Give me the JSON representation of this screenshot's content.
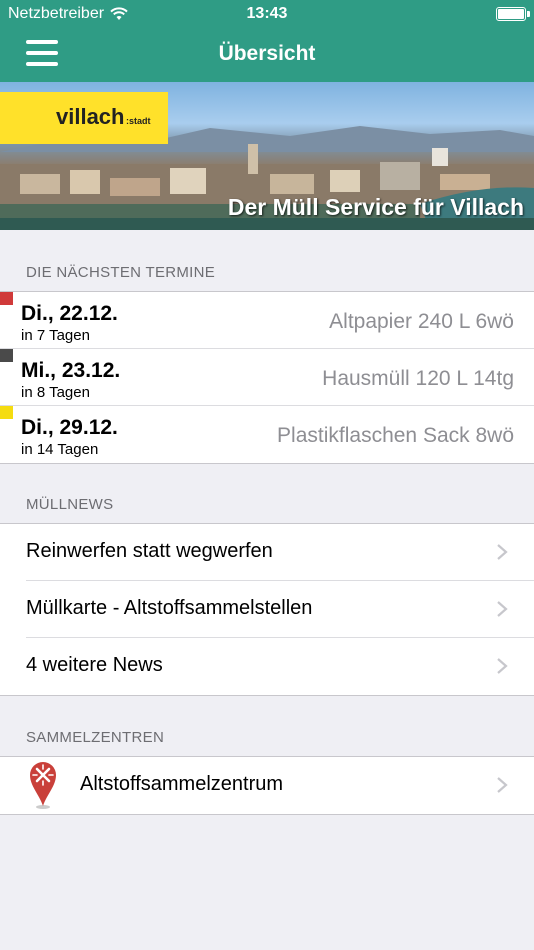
{
  "status_bar": {
    "carrier": "Netzbetreiber",
    "time": "13:43"
  },
  "nav": {
    "title": "Übersicht"
  },
  "banner": {
    "logo_text": "villach",
    "logo_sub": ":stadt",
    "caption": "Der Müll Service für Villach"
  },
  "termine": {
    "header": "DIE NÄCHSTEN TERMINE",
    "items": [
      {
        "date": "Di., 22.12.",
        "relative": "in 7 Tagen",
        "type": "Altpapier 240 L 6wö",
        "color": "#d03a3a"
      },
      {
        "date": "Mi., 23.12.",
        "relative": "in 8 Tagen",
        "type": "Hausmüll 120 L 14tg",
        "color": "#4a4a4a"
      },
      {
        "date": "Di., 29.12.",
        "relative": "in 14 Tagen",
        "type": "Plastikflaschen Sack 8wö",
        "color": "#f5dc10"
      }
    ]
  },
  "news": {
    "header": "MÜLLNEWS",
    "items": [
      {
        "label": "Reinwerfen statt wegwerfen"
      },
      {
        "label": "Müllkarte - Altstoffsammelstellen"
      },
      {
        "label": "4 weitere News"
      }
    ]
  },
  "centers": {
    "header": "SAMMELZENTREN",
    "items": [
      {
        "label": "Altstoffsammelzentrum",
        "icon": "map-pin-icon"
      }
    ]
  },
  "colors": {
    "accent": "#2f9c85",
    "background": "#efeff4",
    "pin": "#c9403a"
  }
}
